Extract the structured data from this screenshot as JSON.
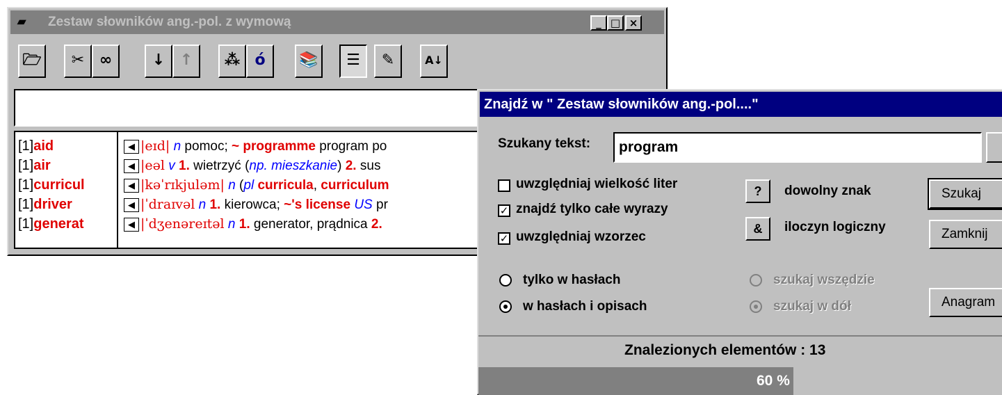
{
  "main_window": {
    "title": "Zestaw słowników ang.-pol. z wymową",
    "toolbar": [
      {
        "name": "open-icon",
        "glyph": "🗁"
      },
      {
        "name": "unlink-icon",
        "glyph": "✂"
      },
      {
        "name": "link-icon",
        "glyph": "∞"
      },
      {
        "name": "arrow-down-icon",
        "glyph": "↓"
      },
      {
        "name": "arrow-up-icon",
        "glyph": "↑"
      },
      {
        "name": "tree-icon",
        "glyph": "⁂"
      },
      {
        "name": "accent-o-icon",
        "glyph": "ó"
      },
      {
        "name": "books-check-icon",
        "glyph": "📚"
      },
      {
        "name": "list-icon",
        "glyph": "☰"
      },
      {
        "name": "new-note-icon",
        "glyph": "✎"
      },
      {
        "name": "sort-az-icon",
        "glyph": "A↓"
      }
    ],
    "entries": [
      {
        "num": "[1]",
        "word": "aid"
      },
      {
        "num": "[1]",
        "word": "air"
      },
      {
        "num": "[1]",
        "word": "curricul"
      },
      {
        "num": "[1]",
        "word": "driver"
      },
      {
        "num": "[1]",
        "word": "generat"
      }
    ],
    "definitions": [
      {
        "ipa": "|eɪd|",
        "pos": "n",
        "t1": " pomoc; ",
        "t2": "~ programme",
        "t3": " program po"
      },
      {
        "ipa": "|eəl",
        "pos": "v",
        "t1": " ",
        "t2": "1.",
        "t3": " wietrzyć (",
        "t4": "np. mieszkanie",
        "t5": ") ",
        "t6": "2.",
        "t7": " sus"
      },
      {
        "ipa": "|kəˈrɪkjuləm|",
        "pos": "n",
        "t1": " (",
        "t2": "pl",
        "t3": " ",
        "t4": "curricula",
        ", ": "",
        "t5": ", ",
        "t6": "curriculum"
      },
      {
        "ipa": "|ˈdraɪvəl",
        "pos": "n",
        "t1": " ",
        "t2": "1.",
        "t3": " kierowca; ",
        "t4": "~'s license",
        "t5": " ",
        "t6": "US",
        "t7": " pr"
      },
      {
        "ipa": "|ˈdʒenəreɪtəl",
        "pos": "n",
        "t1": " ",
        "t2": "1.",
        "t3": " generator, prądnica ",
        "t4": "2.",
        "t5": " "
      }
    ]
  },
  "dialog": {
    "title": "Znajdź w \" Zestaw słowników ang.-pol....\"",
    "search_label": "Szukany tekst:",
    "search_value": "program",
    "chk_case": "uwzględniaj wielkość liter",
    "chk_whole": "znajdź tylko całe wyrazy",
    "chk_pattern": "uwzględniaj wzorzec",
    "q_btn": "?",
    "q_label": "dowolny znak",
    "amp_btn": "&",
    "amp_label": "iloczyn logiczny",
    "btn_search": "Szukaj",
    "btn_close": "Zamknij",
    "btn_anagram": "Anagram",
    "r_headwords": "tylko w hasłach",
    "r_both": "w hasłach i opisach",
    "r_everywhere": "szukaj wszędzie",
    "r_down": "szukaj w dół",
    "found_text": "Znalezionych elementów : 13",
    "progress_percent": 60,
    "progress_label": "60 %"
  }
}
